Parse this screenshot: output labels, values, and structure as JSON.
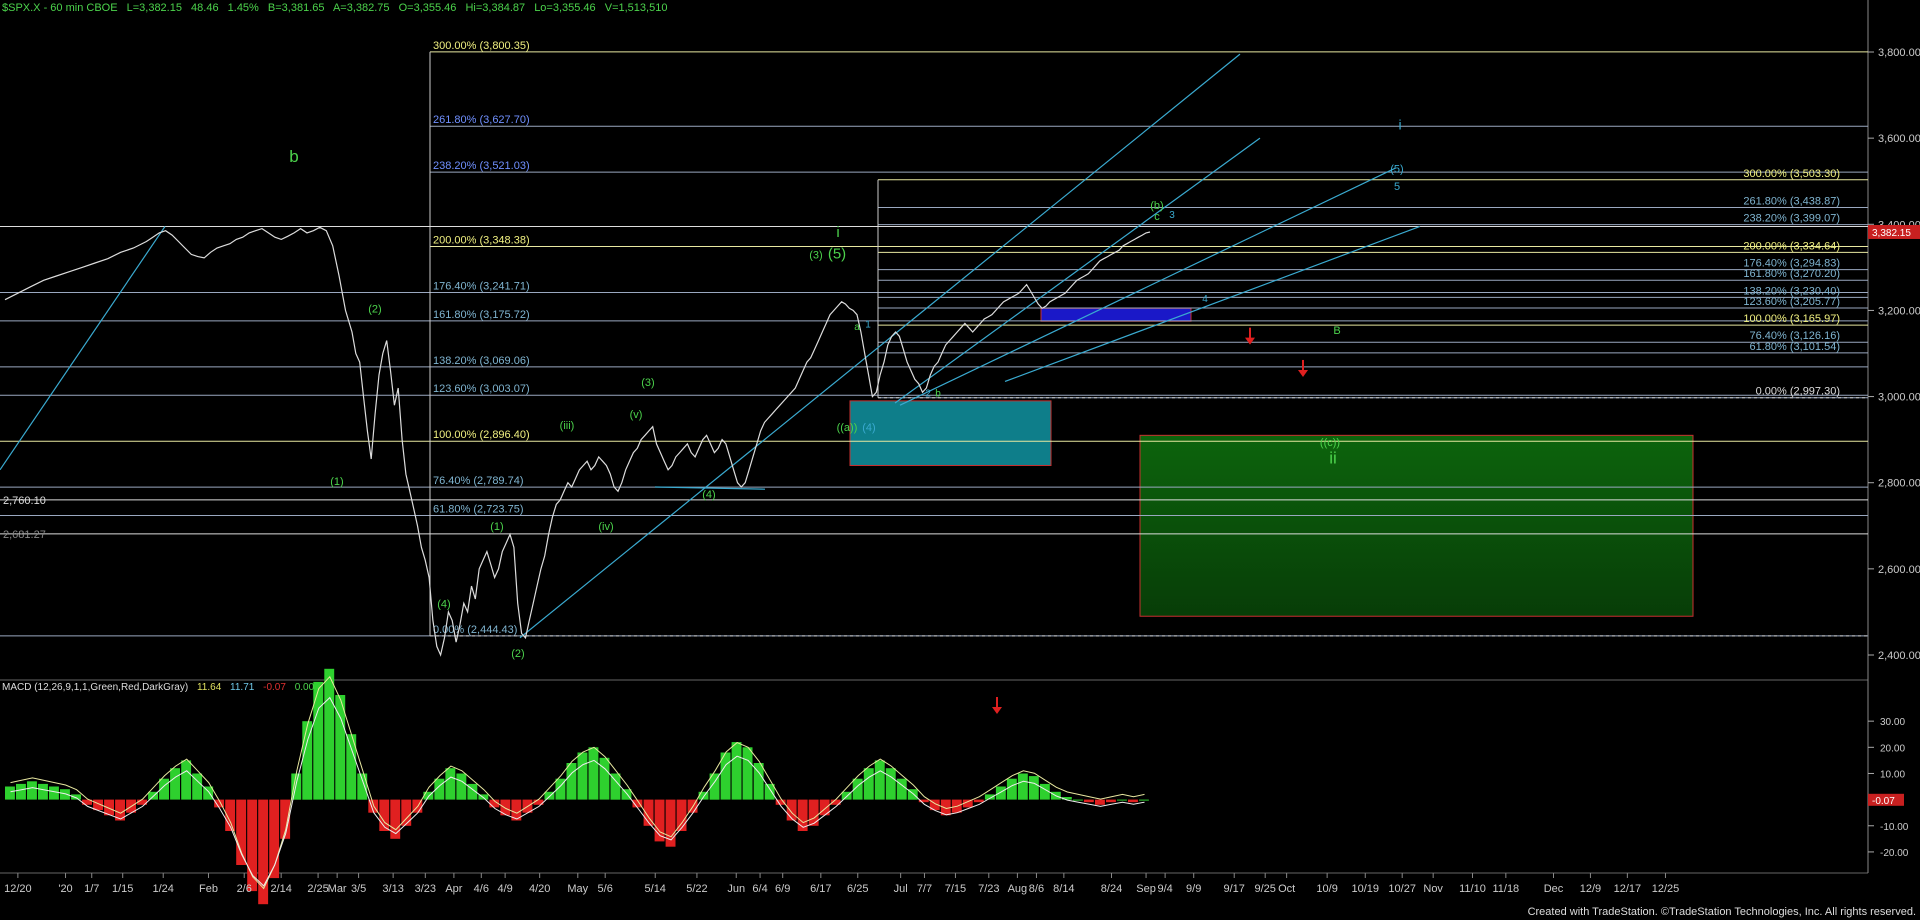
{
  "header": {
    "symbol": "$SPX.X - 60 min  CBOE",
    "last": "L=3,382.15",
    "chg": "48.46",
    "pct": "1.45%",
    "bid": "B=3,381.65",
    "ask": "A=3,382.75",
    "open": "O=3,355.46",
    "high": "Hi=3,384.87",
    "low": "Lo=3,355.46",
    "volume": "V=1,513,510"
  },
  "macd_header": {
    "name": "MACD (12,26,9,1,1,Green,Red,DarkGray)",
    "v1": "11.64",
    "v2": "11.71",
    "v3": "-0.07",
    "v4": "0.00"
  },
  "credit": "Created with TradeStation. ©TradeStation Technologies, Inc. All rights reserved.",
  "colors": {
    "background": "#000000",
    "price": "#dcdcdc",
    "wave": "#3ec43e",
    "fib": "#8fb3ff",
    "channel": "#3aaad0",
    "target_box": "#0a5a0a",
    "support_box": "#0e7e8a",
    "resistance_box": "#1a18c8",
    "arrow": "#e02020",
    "last_price_tag": "#c82020"
  },
  "chart_data": [
    {
      "type": "line",
      "title": "",
      "series_name": "$SPX.X 60 min",
      "ylim": [
        2400,
        3800
      ],
      "y_ticks": [
        "3,800.00",
        "3,600.00",
        "3,400.00",
        "3,200.00",
        "3,000.00",
        "2,800.00",
        "2,600.00",
        "2,400.00"
      ],
      "x_ticks": [
        "12/20",
        "'20",
        "1/7",
        "1/15",
        "1/24",
        "Feb",
        "2/6",
        "2/14",
        "2/25",
        "Mar",
        "3/5",
        "3/13",
        "3/23",
        "Apr",
        "4/6",
        "4/9",
        "4/20",
        "May",
        "5/6",
        "5/14",
        "5/22",
        "Jun",
        "6/4",
        "6/9",
        "6/17",
        "6/25",
        "Jul",
        "7/7",
        "7/15",
        "7/23",
        "Aug",
        "8/6",
        "8/14",
        "8/24",
        "Sep",
        "9/4",
        "9/9",
        "9/17",
        "9/25",
        "Oct",
        "10/9",
        "10/19",
        "10/27",
        "Nov",
        "11/10",
        "11/18",
        "Dec",
        "12/9",
        "12/17",
        "12/25"
      ],
      "last_price": "3,382.15",
      "price_path": [
        [
          0,
          3225
        ],
        [
          10,
          3240
        ],
        [
          20,
          3255
        ],
        [
          30,
          3270
        ],
        [
          40,
          3280
        ],
        [
          50,
          3290
        ],
        [
          60,
          3300
        ],
        [
          70,
          3310
        ],
        [
          80,
          3320
        ],
        [
          90,
          3335
        ],
        [
          100,
          3345
        ],
        [
          110,
          3360
        ],
        [
          115,
          3370
        ],
        [
          120,
          3380
        ],
        [
          125,
          3385
        ],
        [
          130,
          3375
        ],
        [
          135,
          3360
        ],
        [
          140,
          3345
        ],
        [
          145,
          3330
        ],
        [
          150,
          3325
        ],
        [
          155,
          3322
        ],
        [
          160,
          3335
        ],
        [
          165,
          3345
        ],
        [
          170,
          3350
        ],
        [
          175,
          3355
        ],
        [
          180,
          3365
        ],
        [
          185,
          3370
        ],
        [
          190,
          3380
        ],
        [
          195,
          3385
        ],
        [
          200,
          3390
        ],
        [
          205,
          3380
        ],
        [
          210,
          3370
        ],
        [
          215,
          3365
        ],
        [
          220,
          3372
        ],
        [
          225,
          3380
        ],
        [
          230,
          3390
        ],
        [
          235,
          3380
        ],
        [
          240,
          3385
        ],
        [
          245,
          3393
        ],
        [
          250,
          3385
        ],
        [
          255,
          3350
        ],
        [
          260,
          3280
        ],
        [
          265,
          3200
        ],
        [
          270,
          3150
        ],
        [
          273,
          3100
        ],
        [
          276,
          3080
        ],
        [
          279,
          3000
        ],
        [
          282,
          2920
        ],
        [
          285,
          2855
        ],
        [
          288,
          2960
        ],
        [
          291,
          3050
        ],
        [
          294,
          3100
        ],
        [
          297,
          3130
        ],
        [
          300,
          3060
        ],
        [
          303,
          2980
        ],
        [
          306,
          3020
        ],
        [
          309,
          2900
        ],
        [
          312,
          2820
        ],
        [
          315,
          2780
        ],
        [
          318,
          2740
        ],
        [
          321,
          2700
        ],
        [
          324,
          2650
        ],
        [
          327,
          2620
        ],
        [
          330,
          2580
        ],
        [
          333,
          2480
        ],
        [
          336,
          2420
        ],
        [
          339,
          2400
        ],
        [
          342,
          2440
        ],
        [
          345,
          2500
        ],
        [
          348,
          2480
        ],
        [
          351,
          2430
        ],
        [
          354,
          2470
        ],
        [
          357,
          2520
        ],
        [
          360,
          2500
        ],
        [
          363,
          2560
        ],
        [
          366,
          2530
        ],
        [
          369,
          2600
        ],
        [
          372,
          2620
        ],
        [
          375,
          2640
        ],
        [
          378,
          2610
        ],
        [
          381,
          2580
        ],
        [
          384,
          2600
        ],
        [
          387,
          2640
        ],
        [
          390,
          2660
        ],
        [
          393,
          2680
        ],
        [
          396,
          2650
        ],
        [
          399,
          2520
        ],
        [
          402,
          2450
        ],
        [
          405,
          2440
        ],
        [
          408,
          2480
        ],
        [
          411,
          2520
        ],
        [
          414,
          2560
        ],
        [
          417,
          2600
        ],
        [
          420,
          2630
        ],
        [
          423,
          2680
        ],
        [
          426,
          2720
        ],
        [
          429,
          2750
        ],
        [
          432,
          2760
        ],
        [
          435,
          2780
        ],
        [
          438,
          2800
        ],
        [
          441,
          2790
        ],
        [
          444,
          2810
        ],
        [
          447,
          2830
        ],
        [
          450,
          2840
        ],
        [
          453,
          2850
        ],
        [
          456,
          2830
        ],
        [
          459,
          2840
        ],
        [
          462,
          2860
        ],
        [
          465,
          2850
        ],
        [
          468,
          2840
        ],
        [
          471,
          2820
        ],
        [
          474,
          2790
        ],
        [
          477,
          2780
        ],
        [
          480,
          2800
        ],
        [
          483,
          2830
        ],
        [
          486,
          2850
        ],
        [
          489,
          2870
        ],
        [
          492,
          2880
        ],
        [
          495,
          2900
        ],
        [
          498,
          2910
        ],
        [
          501,
          2920
        ],
        [
          504,
          2930
        ],
        [
          507,
          2890
        ],
        [
          510,
          2870
        ],
        [
          513,
          2850
        ],
        [
          516,
          2830
        ],
        [
          519,
          2840
        ],
        [
          522,
          2860
        ],
        [
          525,
          2870
        ],
        [
          528,
          2880
        ],
        [
          531,
          2890
        ],
        [
          534,
          2870
        ],
        [
          537,
          2860
        ],
        [
          540,
          2880
        ],
        [
          543,
          2900
        ],
        [
          546,
          2910
        ],
        [
          549,
          2890
        ],
        [
          552,
          2870
        ],
        [
          555,
          2880
        ],
        [
          558,
          2900
        ],
        [
          561,
          2890
        ],
        [
          564,
          2860
        ],
        [
          567,
          2830
        ],
        [
          570,
          2800
        ],
        [
          573,
          2790
        ],
        [
          576,
          2800
        ],
        [
          579,
          2830
        ],
        [
          582,
          2860
        ],
        [
          585,
          2890
        ],
        [
          588,
          2920
        ],
        [
          591,
          2940
        ],
        [
          594,
          2950
        ],
        [
          597,
          2960
        ],
        [
          600,
          2970
        ],
        [
          603,
          2980
        ],
        [
          606,
          2990
        ],
        [
          609,
          3000
        ],
        [
          612,
          3010
        ],
        [
          615,
          3020
        ],
        [
          618,
          3040
        ],
        [
          621,
          3060
        ],
        [
          624,
          3080
        ],
        [
          627,
          3090
        ],
        [
          630,
          3110
        ],
        [
          633,
          3130
        ],
        [
          636,
          3150
        ],
        [
          639,
          3170
        ],
        [
          642,
          3190
        ],
        [
          645,
          3200
        ],
        [
          648,
          3210
        ],
        [
          651,
          3220
        ],
        [
          654,
          3215
        ],
        [
          657,
          3205
        ],
        [
          660,
          3200
        ],
        [
          663,
          3190
        ],
        [
          666,
          3150
        ],
        [
          669,
          3100
        ],
        [
          672,
          3050
        ],
        [
          675,
          3000
        ],
        [
          678,
          3010
        ],
        [
          681,
          3050
        ],
        [
          684,
          3080
        ],
        [
          687,
          3120
        ],
        [
          690,
          3140
        ],
        [
          693,
          3150
        ],
        [
          696,
          3140
        ],
        [
          699,
          3110
        ],
        [
          702,
          3080
        ],
        [
          705,
          3060
        ],
        [
          708,
          3040
        ],
        [
          711,
          3030
        ],
        [
          714,
          3010
        ],
        [
          717,
          3020
        ],
        [
          720,
          3050
        ],
        [
          723,
          3070
        ],
        [
          726,
          3080
        ],
        [
          729,
          3100
        ],
        [
          732,
          3120
        ],
        [
          735,
          3130
        ],
        [
          738,
          3140
        ],
        [
          741,
          3150
        ],
        [
          744,
          3160
        ],
        [
          747,
          3170
        ],
        [
          750,
          3160
        ],
        [
          753,
          3150
        ],
        [
          756,
          3160
        ],
        [
          759,
          3170
        ],
        [
          762,
          3180
        ],
        [
          765,
          3185
        ],
        [
          768,
          3190
        ],
        [
          771,
          3200
        ],
        [
          774,
          3210
        ],
        [
          777,
          3220
        ],
        [
          780,
          3225
        ],
        [
          783,
          3230
        ],
        [
          786,
          3235
        ],
        [
          789,
          3240
        ],
        [
          792,
          3250
        ],
        [
          795,
          3260
        ],
        [
          798,
          3245
        ],
        [
          801,
          3230
        ],
        [
          804,
          3215
        ],
        [
          807,
          3205
        ],
        [
          810,
          3210
        ],
        [
          813,
          3220
        ],
        [
          816,
          3225
        ],
        [
          819,
          3230
        ],
        [
          822,
          3235
        ],
        [
          825,
          3240
        ],
        [
          828,
          3250
        ],
        [
          831,
          3260
        ],
        [
          834,
          3270
        ],
        [
          837,
          3275
        ],
        [
          840,
          3280
        ],
        [
          843,
          3285
        ],
        [
          846,
          3295
        ],
        [
          849,
          3305
        ],
        [
          852,
          3315
        ],
        [
          855,
          3320
        ],
        [
          858,
          3325
        ],
        [
          861,
          3330
        ],
        [
          864,
          3335
        ],
        [
          867,
          3340
        ],
        [
          870,
          3350
        ],
        [
          873,
          3355
        ],
        [
          876,
          3360
        ],
        [
          879,
          3365
        ],
        [
          882,
          3370
        ],
        [
          885,
          3375
        ],
        [
          888,
          3380
        ],
        [
          891,
          3382
        ]
      ],
      "fib_levels_left": [
        {
          "label": "300.00% (3,800.35)",
          "value": 3800.35
        },
        {
          "label": "261.80% (3,627.70)",
          "value": 3627.7
        },
        {
          "label": "238.20% (3,521.03)",
          "value": 3521.03
        },
        {
          "label": "200.00% (3,348.38)",
          "value": 3348.38
        },
        {
          "label": "176.40% (3,241.71)",
          "value": 3241.71
        },
        {
          "label": "161.80% (3,175.72)",
          "value": 3175.72
        },
        {
          "label": "138.20% (3,069.06)",
          "value": 3069.06
        },
        {
          "label": "123.60% (3,003.07)",
          "value": 3003.07
        },
        {
          "label": "100.00% (2,896.40)",
          "value": 2896.4
        },
        {
          "label": "76.40% (2,789.74)",
          "value": 2789.74
        },
        {
          "label": "61.80% (2,723.75)",
          "value": 2723.75
        },
        {
          "label": "0.00% (2,444.43)",
          "value": 2444.43
        }
      ],
      "fib_levels_right": [
        {
          "label": "300.00% (3,503.30)",
          "value": 3503.3
        },
        {
          "label": "261.80% (3,438.87)",
          "value": 3438.87
        },
        {
          "label": "238.20% (3,399.07)",
          "value": 3399.07
        },
        {
          "label": "200.00% (3,334.64)",
          "value": 3334.64
        },
        {
          "label": "176.40% (3,294.83)",
          "value": 3294.83
        },
        {
          "label": "161.80% (3,270.20)",
          "value": 3270.2
        },
        {
          "label": "138.20% (3,230.40)",
          "value": 3230.4
        },
        {
          "label": "123.60% (3,205.77)",
          "value": 3205.77
        },
        {
          "label": "100.00% (3,165.97)",
          "value": 3165.97
        },
        {
          "label": "76.40% (3,126.16)",
          "value": 3126.16
        },
        {
          "label": "61.80% (3,101.54)",
          "value": 3101.54
        },
        {
          "label": "0.00% (2,997.30)",
          "value": 2997.3
        }
      ],
      "horizontal_labels": [
        {
          "label": "2,760.10",
          "value": 2760.1
        },
        {
          "label": "2,681.27",
          "value": 2681.27
        }
      ],
      "wave_labels": [
        "b",
        "(2)",
        "(1)",
        "(4)",
        "(2)",
        "(1)",
        "(iii)",
        "(iv)",
        "(3)",
        "(v)",
        "(4)",
        "(3)",
        "(5)",
        "i",
        "((a))",
        "(4)",
        "a",
        "1",
        "2",
        "b",
        "(b)",
        "c",
        "3",
        "4",
        "B",
        "((c))",
        "ii",
        "(5)",
        "5",
        "i"
      ]
    },
    {
      "type": "bar",
      "title": "MACD (12,26,9,1,1,Green,Red,DarkGray)",
      "ylim": [
        -25,
        40
      ],
      "y_ticks": [
        "30.00",
        "20.00",
        "10.00",
        "-10.00",
        "-20.00"
      ],
      "last_value": "-0.07",
      "histogram_pattern": [
        5,
        6,
        7,
        6,
        5,
        4,
        2,
        -2,
        -4,
        -6,
        -8,
        -5,
        -2,
        3,
        8,
        12,
        15,
        10,
        5,
        -3,
        -12,
        -25,
        -35,
        -40,
        -30,
        -15,
        10,
        30,
        45,
        50,
        40,
        25,
        10,
        -5,
        -12,
        -15,
        -10,
        -5,
        3,
        8,
        12,
        10,
        6,
        2,
        -3,
        -6,
        -8,
        -5,
        -2,
        3,
        8,
        14,
        18,
        20,
        16,
        10,
        4,
        -3,
        -10,
        -16,
        -18,
        -12,
        -5,
        3,
        10,
        18,
        22,
        20,
        14,
        6,
        -2,
        -8,
        -12,
        -10,
        -6,
        -2,
        3,
        8,
        12,
        15,
        12,
        8,
        4,
        -1,
        -4,
        -6,
        -5,
        -3,
        -1,
        2,
        5,
        8,
        10,
        9,
        6,
        3,
        1,
        0,
        -1,
        -2,
        -1,
        0,
        -1,
        0
      ]
    }
  ]
}
